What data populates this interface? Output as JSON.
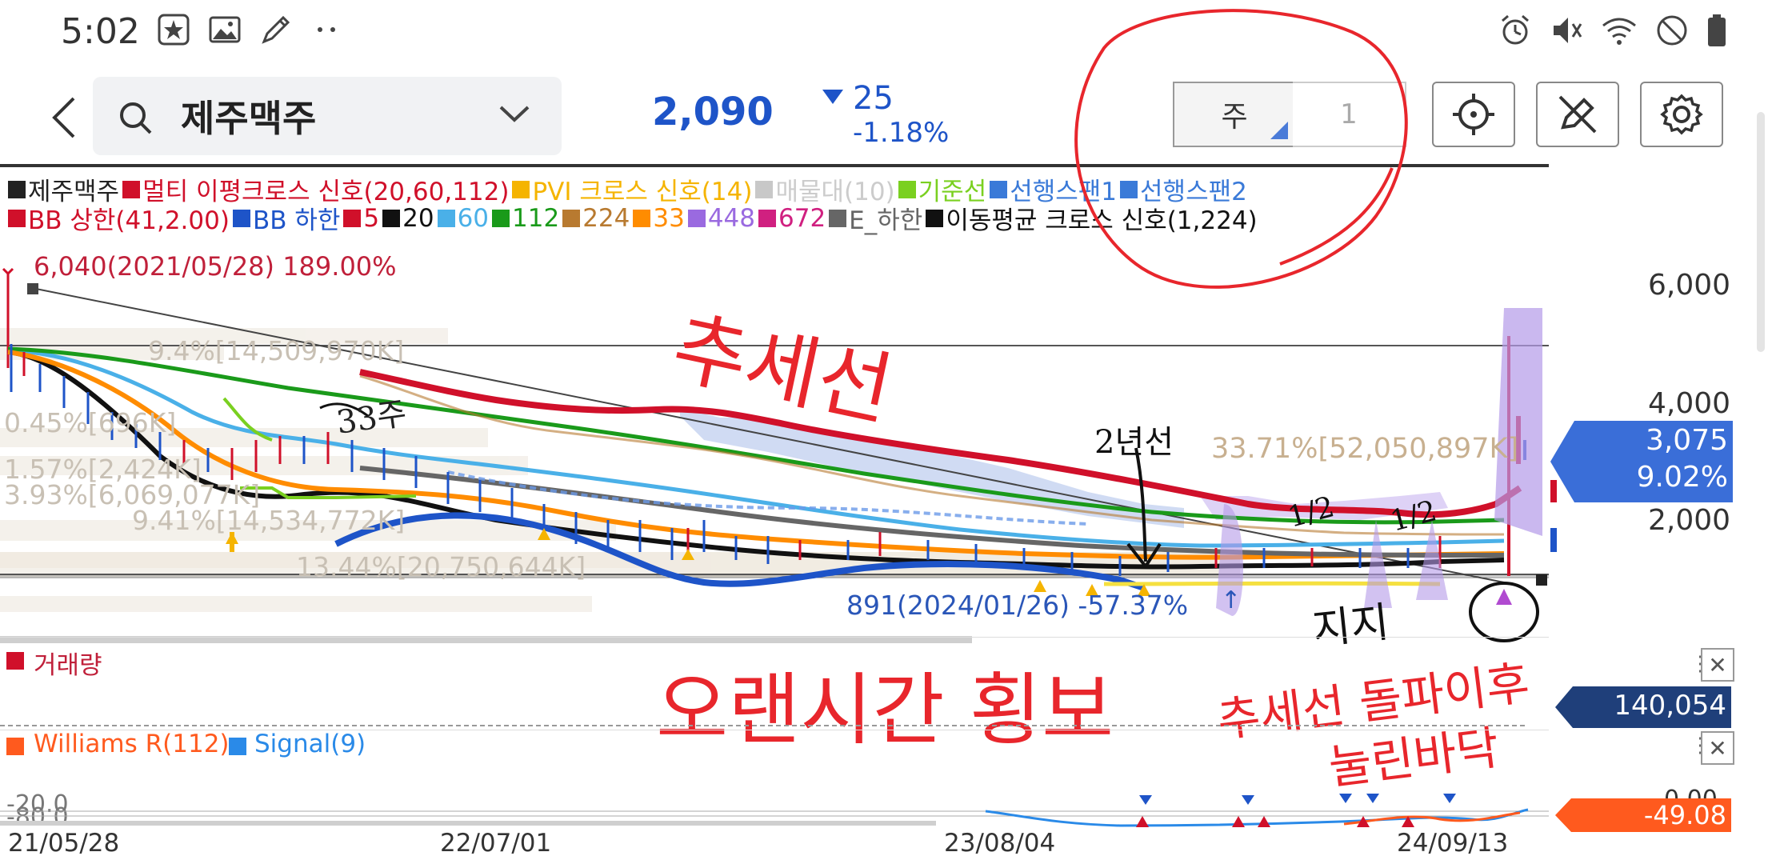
{
  "status": {
    "time": "5:02",
    "left_icons": [
      "star-badge-icon",
      "gallery-icon",
      "pen-icon",
      "more-dots-icon"
    ],
    "right_icons": [
      "alarm-icon",
      "mute-icon",
      "wifi-icon",
      "no-disturb-icon",
      "battery-icon"
    ]
  },
  "header": {
    "stock_name": "제주맥주",
    "price": "2,090",
    "change": "25",
    "change_pct": "-1.18%",
    "period": "주",
    "interval": "1"
  },
  "legend": {
    "row1": [
      {
        "text": "제주맥주",
        "color": "#222222"
      },
      {
        "text": "멀티 이평크로스 신호(20,60,112)",
        "color": "#d0102a"
      },
      {
        "text": "PVI 크로스 신호(14)",
        "color": "#f5b400"
      },
      {
        "text": "매물대(10)",
        "color": "#c8c8c8"
      },
      {
        "text": "기준선",
        "color": "#7ad020"
      },
      {
        "text": "선행스팬1",
        "color": "#3a7ad8"
      },
      {
        "text": "선행스팬2",
        "color": "#3a7ad8"
      }
    ],
    "row2": [
      {
        "text": "BB 상한(41,2.00)",
        "color": "#d0102a"
      },
      {
        "text": "BB 하한",
        "color": "#1e54c8"
      },
      {
        "text": "5",
        "color": "#d0102a"
      },
      {
        "text": "20",
        "color": "#111111"
      },
      {
        "text": "60",
        "color": "#4ab0e8"
      },
      {
        "text": "112",
        "color": "#1a9a1a"
      },
      {
        "text": "224",
        "color": "#b87a30"
      },
      {
        "text": "33",
        "color": "#ff8c00"
      },
      {
        "text": "448",
        "color": "#9a6ae0"
      },
      {
        "text": "672",
        "color": "#d02080"
      },
      {
        "text": "E_하한",
        "color": "#666666"
      },
      {
        "text": "이동평균 크로스 신호(1,224)",
        "color": "#111111"
      }
    ]
  },
  "chart": {
    "high_label": "6,040(2021/05/28) 189.00%",
    "low_label": "891(2024/01/26) -57.37%",
    "volume_profile": [
      "9.4%[14,509,970K]",
      "0.45%[696K]",
      "1.57%[2,424K]",
      "3.93%[6,069,077K]",
      "9.41%[14,534,772K]",
      "13.44%[20,750,644K]",
      "33.71%[52,050,897K]"
    ],
    "y_ticks": [
      "6,000",
      "4,000",
      "2,000"
    ],
    "current_price": "3,075",
    "current_pct": "9.02%",
    "x_ticks": [
      "21/05/28",
      "22/07/01",
      "23/08/04",
      "24/09/13"
    ]
  },
  "volume_panel": {
    "label": "거래량",
    "value": "140,054"
  },
  "wr_panel": {
    "label1": "Williams R(112)",
    "label2": "Signal(9)",
    "level1": "-20.0",
    "level2": "-80.0",
    "zero": "0.00",
    "value": "-49.08"
  },
  "annotations": {
    "trendline": "추세선",
    "sideways": "오랜시간  횡보",
    "breakout": "추세선  돌파이후",
    "pressed": "눌린바닥",
    "support": "지지",
    "weeks_33": "33주",
    "two_year": "2년선",
    "half": "1/2",
    "half2": "1/2"
  },
  "colors": {
    "accent_blue": "#1e54c8",
    "annotation_red": "#e8262c",
    "price_tag_bg": "#3a6ed8",
    "wr_tag_bg": "#ff5a1e"
  }
}
